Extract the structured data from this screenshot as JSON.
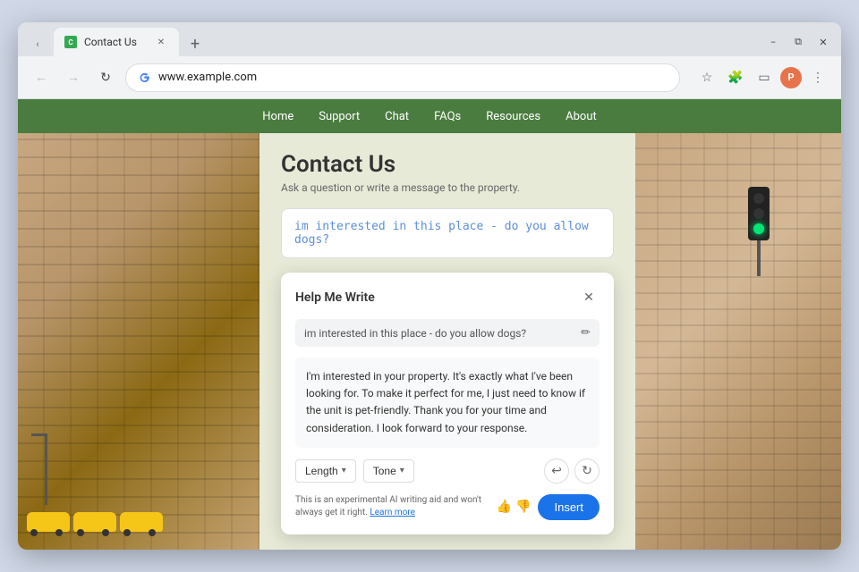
{
  "browser": {
    "tab_title": "Contact Us",
    "url": "www.example.com",
    "minimize_label": "−",
    "maximize_label": "⧉",
    "close_label": "✕",
    "back_icon": "←",
    "forward_icon": "→",
    "refresh_icon": "↻",
    "favicon_letter": "C",
    "profile_initial": "P"
  },
  "nav": {
    "items": [
      {
        "label": "Home"
      },
      {
        "label": "Support"
      },
      {
        "label": "Chat"
      },
      {
        "label": "FAQs"
      },
      {
        "label": "Resources"
      },
      {
        "label": "About"
      }
    ]
  },
  "contact": {
    "title": "Contact Us",
    "subtitle": "Ask a question or write a message to the property.",
    "input_value": "im interested in this place - do you allow dogs?"
  },
  "help_write": {
    "title": "Help Me Write",
    "prompt_text": "im interested in this place - do you allow dogs?",
    "generated_text": "I'm interested in your property. It's exactly what I've been looking for. To make it perfect for me, I just need to know if the unit is pet-friendly. Thank you for your time and consideration. I look forward to your response.",
    "length_label": "Length",
    "tone_label": "Tone",
    "insert_label": "Insert",
    "disclaimer": "This is an experimental AI writing aid and won't always get it right.",
    "learn_more": "Learn more",
    "close_icon": "✕",
    "edit_icon": "✏",
    "undo_icon": "↩",
    "refresh_icon": "↻",
    "thumbup_icon": "👍",
    "thumbdown_icon": "👎",
    "dropdown_arrow": "▾"
  }
}
